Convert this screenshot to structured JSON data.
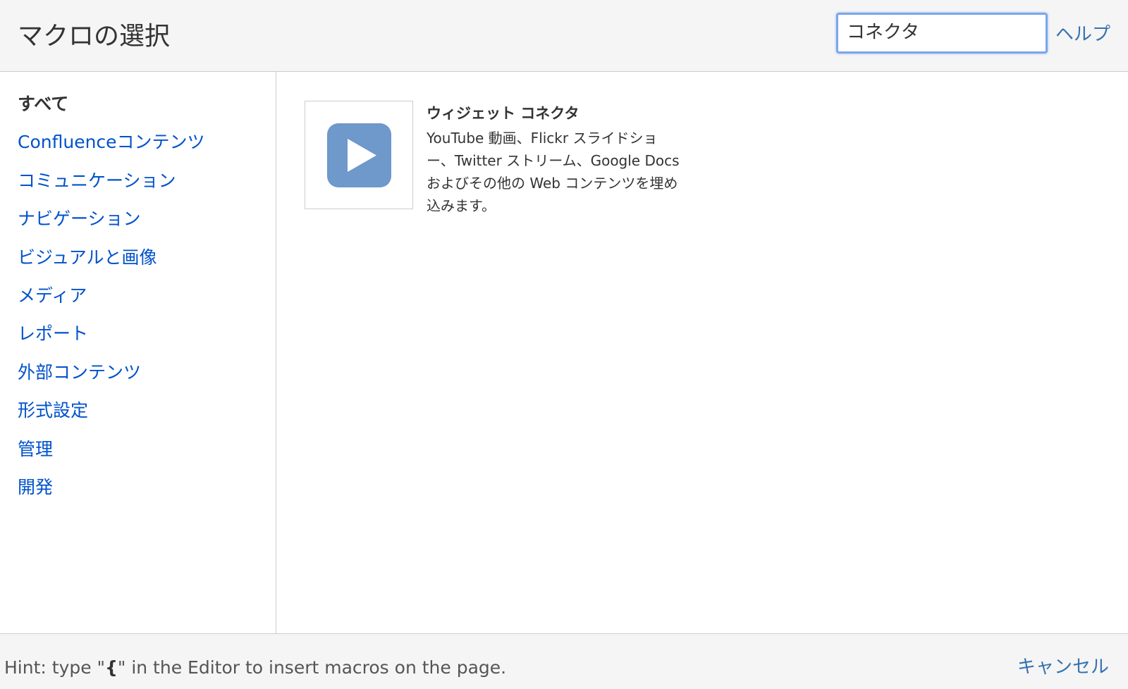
{
  "header": {
    "title": "マクロの選択",
    "search_value": "コネクタ",
    "help_label": "ヘルプ"
  },
  "sidebar": {
    "categories": [
      {
        "label": "すべて",
        "selected": true
      },
      {
        "label": "Confluenceコンテンツ"
      },
      {
        "label": "コミュニケーション"
      },
      {
        "label": "ナビゲーション"
      },
      {
        "label": "ビジュアルと画像"
      },
      {
        "label": "メディア"
      },
      {
        "label": "レポート"
      },
      {
        "label": "外部コンテンツ"
      },
      {
        "label": "形式設定"
      },
      {
        "label": "管理"
      },
      {
        "label": "開発"
      }
    ]
  },
  "results": [
    {
      "name": "ウィジェット コネクタ",
      "description": "YouTube 動画、Flickr スライドショー、Twitter ストリーム、Google Docs およびその他の Web コンテンツを埋め込みます。",
      "icon": "play-icon",
      "icon_color": "#6f98cb"
    }
  ],
  "footer": {
    "hint_prefix": "Hint: type \"",
    "hint_key": "{",
    "hint_suffix": "\" in the Editor to insert macros on the page.",
    "cancel_label": "キャンセル"
  },
  "colors": {
    "link": "#0052cc",
    "focus_ring": "#7ba7ec",
    "panel_bg": "#f5f5f5"
  }
}
